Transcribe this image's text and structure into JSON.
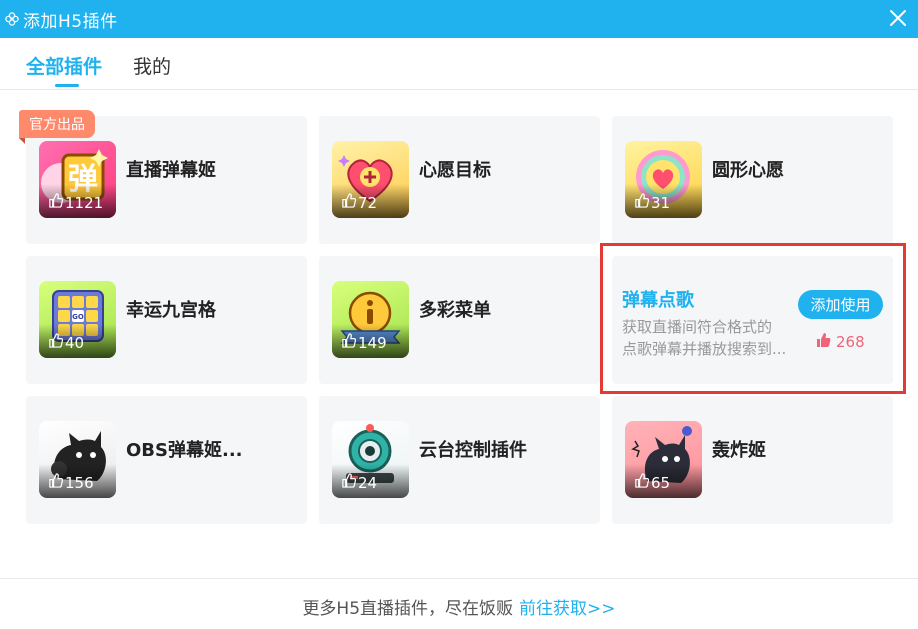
{
  "window": {
    "title": "添加H5插件",
    "logo_icon": "flower-icon",
    "close_icon": "close-icon"
  },
  "tabs": [
    {
      "label": "全部插件",
      "active": true
    },
    {
      "label": "我的",
      "active": false
    }
  ],
  "badge": {
    "label": "官方出品"
  },
  "plugins": [
    {
      "name": "直播弹幕姬",
      "likes": "1121",
      "icon": "danmaku-icon"
    },
    {
      "name": "心愿目标",
      "likes": "72",
      "icon": "heart-plus-icon"
    },
    {
      "name": "圆形心愿",
      "likes": "31",
      "icon": "ring-heart-icon"
    },
    {
      "name": "幸运九宫格",
      "likes": "40",
      "icon": "grid-go-icon"
    },
    {
      "name": "多彩菜单",
      "likes": "149",
      "icon": "info-ribbon-icon"
    },
    {
      "name": "OBS弹幕姬...",
      "likes": "156",
      "icon": "black-cat-icon"
    },
    {
      "name": "云台控制插件",
      "likes": "24",
      "icon": "webcam-icon"
    },
    {
      "name": "轰炸姬",
      "likes": "65",
      "icon": "bomb-cat-icon"
    }
  ],
  "highlighted": {
    "name": "弹幕点歌",
    "desc_line1": "获取直播间符合格式的",
    "desc_line2": "点歌弹幕并播放搜索到...",
    "button": "添加使用",
    "likes": "268"
  },
  "footer": {
    "text": "更多H5直播插件，尽在饭贩",
    "link": "前往获取>>"
  },
  "colors": {
    "accent": "#1fb2ee",
    "badge": "#ff8a6b",
    "highlight_border": "#e53935",
    "likes_pink": "#f0647a"
  }
}
